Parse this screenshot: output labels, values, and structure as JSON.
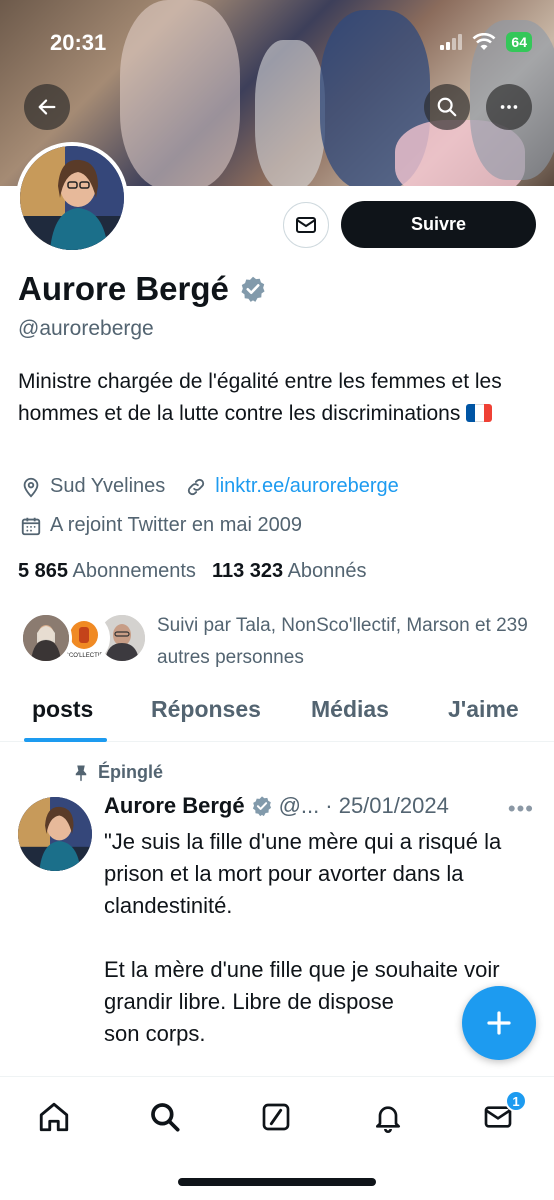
{
  "status_bar": {
    "time": "20:31",
    "battery": "64"
  },
  "profile": {
    "display_name": "Aurore Bergé",
    "handle": "@auroreberge",
    "bio": "Ministre chargée de l'égalité entre les femmes et les hommes et de la lutte contre les discriminations",
    "location": "Sud Yvelines",
    "link": "linktr.ee/auroreberge",
    "joined": "A rejoint Twitter en mai 2009",
    "follow_label": "Suivre",
    "following_count": "5 865",
    "following_label": "Abonnements",
    "followers_count": "113 323",
    "followers_label": "Abonnés",
    "followed_by_text": "Suivi par Tala, NonSco'llectif, Marson et 239 autres personnes"
  },
  "tabs": [
    {
      "label": "posts",
      "active": true
    },
    {
      "label": "Réponses",
      "active": false
    },
    {
      "label": "Médias",
      "active": false
    },
    {
      "label": "J'aime",
      "active": false
    }
  ],
  "pinned_post": {
    "pinned_label": "Épinglé",
    "author": "Aurore Bergé",
    "handle_trunc": "@...",
    "date": "· 25/01/2024",
    "text": "\"Je suis la fille d'une mère qui a risqué la prison et la mort pour avorter dans la clandestinité.\n\nEt la mère d'une fille que je souhaite voir grandir libre. Libre de dispose\nson corps."
  },
  "nav": {
    "messages_badge": "1"
  },
  "colors": {
    "accent": "#1d9bf0",
    "text": "#0f1419",
    "muted": "#536471",
    "verified": "#829aab"
  },
  "icons": [
    "back-arrow-icon",
    "search-icon",
    "more-icon",
    "mail-icon",
    "verified-icon",
    "location-icon",
    "link-icon",
    "calendar-icon",
    "pin-icon",
    "plus-icon",
    "home-icon",
    "compose-icon",
    "bell-icon",
    "envelope-icon"
  ]
}
